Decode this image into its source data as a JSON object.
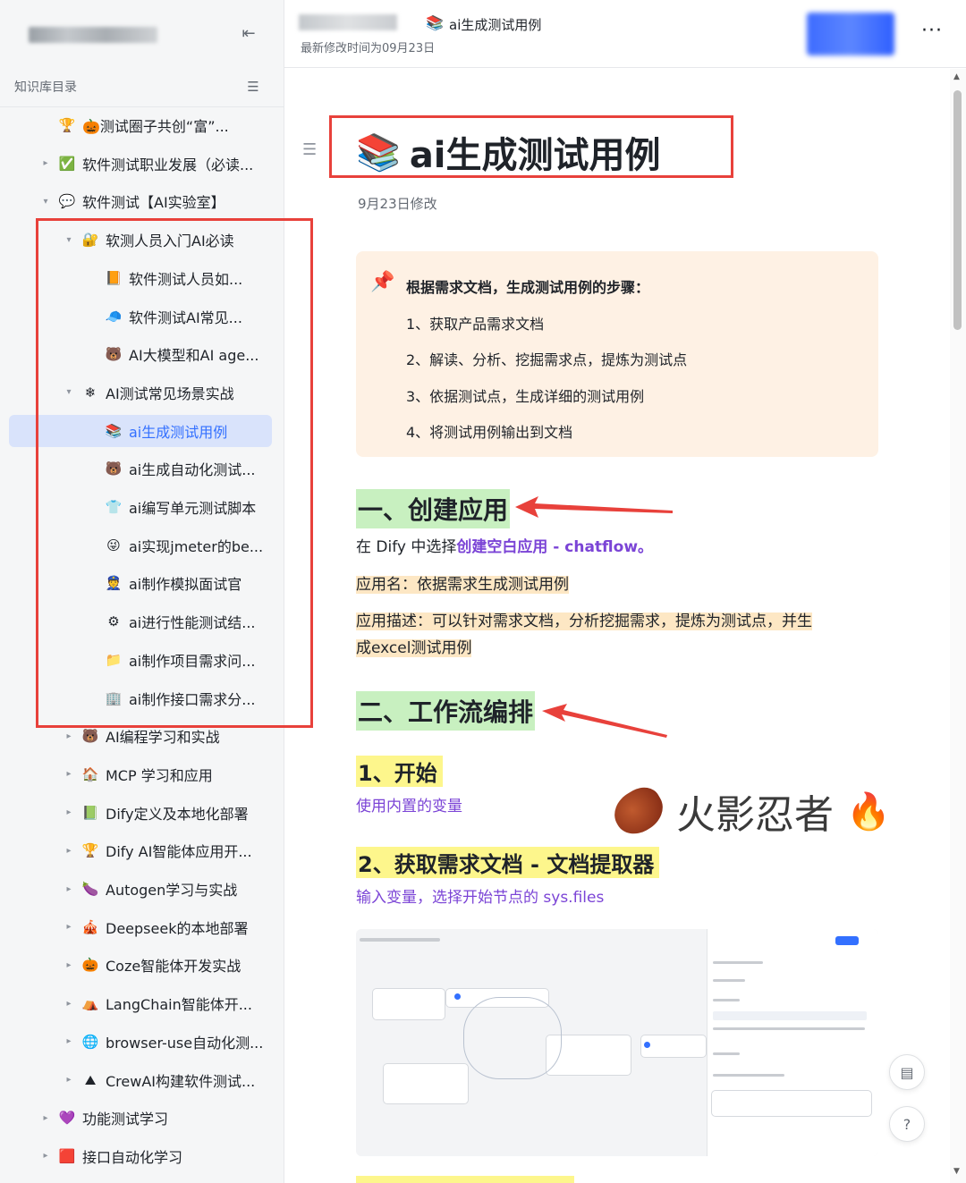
{
  "sidebar": {
    "catalog_title": "知识库目录",
    "items": [
      {
        "label": "🎃测试圈子共创“富”...",
        "icon": "🏆",
        "arrow": "",
        "indent": 0
      },
      {
        "label": "软件测试职业发展（必读...",
        "icon": "✅",
        "arrow": "▸",
        "indent": 0
      },
      {
        "label": "软件测试【AI实验室】",
        "icon": "💬",
        "arrow": "▾",
        "indent": 0
      },
      {
        "label": "软测人员入门AI必读",
        "icon": "🔐",
        "arrow": "▾",
        "indent": 1
      },
      {
        "label": "软件测试人员如...",
        "icon": "📙",
        "arrow": "",
        "indent": 2
      },
      {
        "label": "软件测试AI常见...",
        "icon": "🧢",
        "arrow": "",
        "indent": 2
      },
      {
        "label": "AI大模型和AI age...",
        "icon": "🐻",
        "arrow": "",
        "indent": 2
      },
      {
        "label": "AI测试常见场景实战",
        "icon": "❄",
        "arrow": "▾",
        "indent": 1
      },
      {
        "label": "ai生成测试用例",
        "icon": "📚",
        "arrow": "",
        "indent": 2,
        "active": true
      },
      {
        "label": "ai生成自动化测试...",
        "icon": "🐻",
        "arrow": "",
        "indent": 2
      },
      {
        "label": "ai编写单元测试脚本",
        "icon": "👕",
        "arrow": "",
        "indent": 2
      },
      {
        "label": "ai实现jmeter的be...",
        "icon": "😜",
        "arrow": "",
        "indent": 2
      },
      {
        "label": "ai制作模拟面试官",
        "icon": "👮",
        "arrow": "",
        "indent": 2
      },
      {
        "label": "ai进行性能测试结...",
        "icon": "⚙",
        "arrow": "",
        "indent": 2
      },
      {
        "label": "ai制作项目需求问...",
        "icon": "📁",
        "arrow": "",
        "indent": 2
      },
      {
        "label": "ai制作接口需求分...",
        "icon": "🏢",
        "arrow": "",
        "indent": 2
      },
      {
        "label": "AI编程学习和实战",
        "icon": "🐻",
        "arrow": "▸",
        "indent": 1
      },
      {
        "label": "MCP 学习和应用",
        "icon": "🏠",
        "arrow": "▸",
        "indent": 1
      },
      {
        "label": "Dify定义及本地化部署",
        "icon": "📗",
        "arrow": "▸",
        "indent": 1
      },
      {
        "label": "Dify AI智能体应用开...",
        "icon": "🏆",
        "arrow": "▸",
        "indent": 1
      },
      {
        "label": "Autogen学习与实战",
        "icon": "🍆",
        "arrow": "▸",
        "indent": 1
      },
      {
        "label": "Deepseek的本地部署",
        "icon": "🎪",
        "arrow": "▸",
        "indent": 1
      },
      {
        "label": "Coze智能体开发实战",
        "icon": "🎃",
        "arrow": "▸",
        "indent": 1
      },
      {
        "label": "LangChain智能体开...",
        "icon": "⛺",
        "arrow": "▸",
        "indent": 1
      },
      {
        "label": "browser-use自动化测...",
        "icon": "🌐",
        "arrow": "▸",
        "indent": 1
      },
      {
        "label": "CrewAI构建软件测试...",
        "icon": "⛰",
        "arrow": "▸",
        "indent": 1
      },
      {
        "label": "功能测试学习",
        "icon": "💜",
        "arrow": "▸",
        "indent": 0
      },
      {
        "label": "接口自动化学习",
        "icon": "🟥",
        "arrow": "▸",
        "indent": 0
      }
    ]
  },
  "header": {
    "doc_icon": "📚",
    "doc_title": "ai生成测试用例",
    "modified": "最新修改时间为09月23日",
    "more": "···"
  },
  "doc": {
    "title": "ai生成测试用例",
    "date": "9月23日修改",
    "callout": {
      "heading": "根据需求文档，生成测试用例的步骤：",
      "steps": [
        "1、获取产品需求文档",
        "2、解读、分析、挖掘需求点，提炼为测试点",
        "3、依据测试点，生成详细的测试用例",
        "4、将测试用例输出到文档"
      ]
    },
    "section1": "一、创建应用",
    "p1_prefix": "在 Dify 中选择",
    "p1_highlight": "创建空白应用 - chatflow。",
    "p2_label": "应用名：",
    "p2_value": "依据需求生成测试用例",
    "p3_line1": "应用描述：可以针对需求文档，分析挖掘需求，提炼为测试点，并生",
    "p3_line2": "成excel测试用例",
    "section2": "二、工作流编排",
    "sub1": "1、开始",
    "sub1_text": "使用内置的变量",
    "sub2": "2、获取需求文档 - 文档提取器",
    "sub2_text": "输入变量，选择开始节点的 sys.files",
    "watermark_text": "火影忍者",
    "watermark_fire": "🔥"
  },
  "colors": {
    "accent": "#3370ff",
    "annotation_red": "#e8413b",
    "callout_bg": "#fef1e4",
    "h1_bg": "#c8f0c0",
    "h2_bg": "#fdf68c",
    "link_purple": "#7b44d6"
  }
}
